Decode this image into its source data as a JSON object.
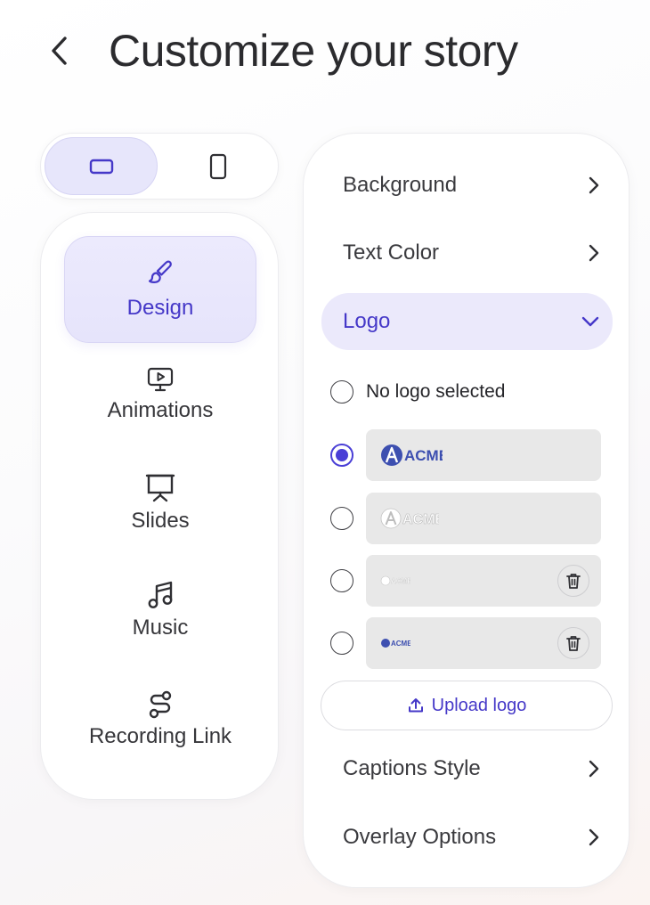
{
  "header": {
    "title": "Customize your story",
    "back_icon": "chevron-left-icon"
  },
  "view_toggle": {
    "options": [
      {
        "icon": "landscape-screen-icon",
        "active": true
      },
      {
        "icon": "portrait-screen-icon",
        "active": false
      }
    ]
  },
  "sidebar": {
    "items": [
      {
        "label": "Design",
        "icon": "brush-icon",
        "active": true
      },
      {
        "label": "Animations",
        "icon": "presentation-play-icon",
        "active": false
      },
      {
        "label": "Slides",
        "icon": "easel-icon",
        "active": false
      },
      {
        "label": "Music",
        "icon": "music-note-icon",
        "active": false
      },
      {
        "label": "Recording Link",
        "icon": "route-icon",
        "active": false
      }
    ]
  },
  "panel": {
    "sections": {
      "background": "Background",
      "text_color": "Text Color",
      "logo": "Logo",
      "captions_style": "Captions Style",
      "overlay_options": "Overlay Options"
    },
    "logo_options": {
      "no_logo_label": "No logo selected",
      "logos": [
        {
          "brand": "ACME",
          "variant": "blue",
          "selected": true,
          "deletable": false
        },
        {
          "brand": "ACME",
          "variant": "white",
          "selected": false,
          "deletable": false
        },
        {
          "brand": "ACME",
          "variant": "white-small",
          "selected": false,
          "deletable": true
        },
        {
          "brand": "ACME",
          "variant": "blue-small",
          "selected": false,
          "deletable": true
        }
      ]
    },
    "upload_label": "Upload logo"
  },
  "colors": {
    "accent": "#4538c8",
    "accent_bg": "#ebe9fb",
    "logo_blue": "#3d4fb0"
  }
}
